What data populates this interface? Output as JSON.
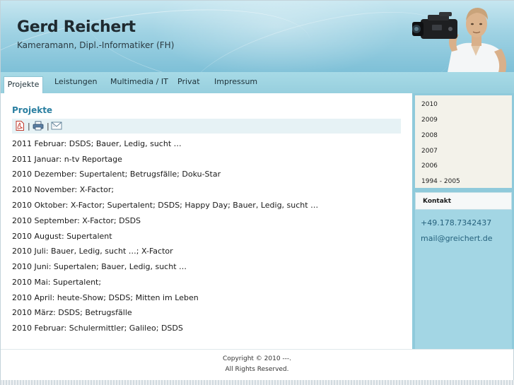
{
  "header": {
    "title": "Gerd Reichert",
    "subtitle": "Kameramann, Dipl.-Informatiker (FH)"
  },
  "nav": {
    "items": [
      {
        "label": "Projekte",
        "active": true
      },
      {
        "label": "Leistungen"
      },
      {
        "label": "Multimedia / IT"
      },
      {
        "label": "Privat"
      },
      {
        "label": "Impressum"
      }
    ]
  },
  "main": {
    "heading": "Projekte",
    "toolbar": {
      "icons": [
        "pdf-icon",
        "print-icon",
        "email-icon"
      ],
      "separator": "|"
    },
    "entries": [
      "2011 Februar: DSDS; Bauer, Ledig, sucht …",
      "2011 Januar: n-tv Reportage",
      "2010 Dezember: Supertalent; Betrugsfälle; Doku-Star",
      "2010 November: X-Factor;",
      "2010 Oktober: X-Factor; Supertalent; DSDS; Happy Day; Bauer, Ledig, sucht …",
      "2010 September: X-Factor; DSDS",
      "2010 August: Supertalent",
      "2010 Juli: Bauer, Ledig, sucht …; X-Factor",
      "2010 Juni: Supertalen; Bauer, Ledig, sucht …",
      "2010 Mai: Supertalent;",
      "2010 April: heute-Show; DSDS; Mitten im Leben",
      "2010 März: DSDS; Betrugsfälle",
      "2010 Februar: Schulermittler; Galileo; DSDS"
    ]
  },
  "sidebar": {
    "years": [
      "2010",
      "2009",
      "2008",
      "2007",
      "2006",
      "1994 - 2005"
    ],
    "contact": {
      "title": "Kontakt",
      "phone": "+49.178.7342437",
      "email": "mail@greichert.de"
    }
  },
  "footer": {
    "copyright": "Copyright © 2010 ---.",
    "rights": "All Rights Reserved."
  },
  "colors": {
    "accent": "#2a7fa1",
    "nav_bg": "#a7dae6",
    "sidebar_bg": "#8fcadb",
    "year_box_bg": "#f3f2ea",
    "contact_text": "#25617c"
  }
}
